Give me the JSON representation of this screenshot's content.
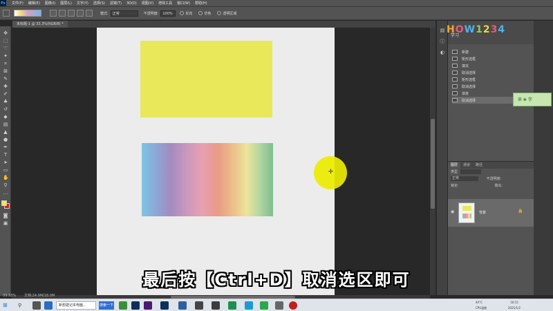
{
  "menubar": {
    "items": [
      "文件(F)",
      "编辑(E)",
      "图像(I)",
      "图层(L)",
      "文字(Y)",
      "选择(S)",
      "滤镜(T)",
      "3D(D)",
      "视图(V)",
      "增效工具",
      "窗口(W)",
      "帮助(H)"
    ]
  },
  "optionsbar": {
    "mode_label": "模式:",
    "mode_value": "正常",
    "opacity_label": "不透明度:",
    "opacity_value": "100%",
    "reverse_label": "反向",
    "dither_label": "仿色",
    "transparency_label": "透明区域"
  },
  "document": {
    "tab_title": "未标题-1 @ 33.3%(RGB/8) *",
    "zoom": "33.33%",
    "doc_info": "文档:24.9M/18.0M"
  },
  "colors": {
    "yellow_rect": "#e9e85a",
    "gradient": [
      "#7ec4e4",
      "#a48bc0",
      "#e7a0b1",
      "#e99b86",
      "#ebe59a",
      "#7fbd90"
    ],
    "foreground": "#eaea4f",
    "background": "#e01818"
  },
  "caption": "最后按【Ctrl+D】取消选区即可",
  "right_panel": {
    "learn_label": "学习",
    "history": [
      "新建",
      "矩形选框",
      "填充",
      "取消选择",
      "矩形选框",
      "取消选择",
      "渐变",
      "取消选择"
    ],
    "active_history_index": 7
  },
  "layers_panel": {
    "tabs": [
      "图层",
      "通道",
      "路径"
    ],
    "kind_label": "类型",
    "blend_mode": "正常",
    "opacity_label": "不透明度:",
    "lock_label": "锁定:",
    "fill_label": "填充:",
    "layer_name": "背景"
  },
  "watermark": {
    "logo": "HOW1234",
    "badge": "来 ❀ 学"
  },
  "taskbar": {
    "window_title": "新想建记本电脑...",
    "search_btn": "搜索一下",
    "temp": "44°C",
    "cpu_label": "CPU温度",
    "time": "16:15",
    "date": "2021/1/2"
  }
}
